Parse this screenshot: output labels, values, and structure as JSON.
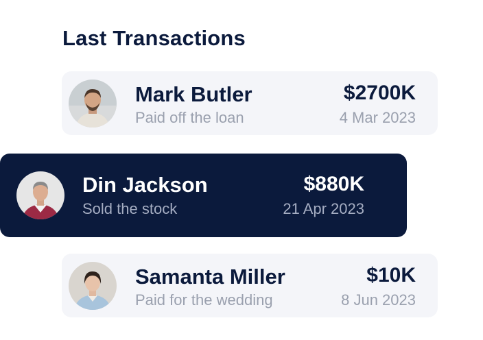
{
  "section": {
    "title": "Last Transactions"
  },
  "transactions": [
    {
      "name": "Mark Butler",
      "description": "Paid off the loan",
      "amount": "$2700K",
      "date": "4 Mar 2023",
      "highlighted": false
    },
    {
      "name": "Din Jackson",
      "description": "Sold the stock",
      "amount": "$880K",
      "date": "21 Apr 2023",
      "highlighted": true
    },
    {
      "name": "Samanta Miller",
      "description": "Paid for the wedding",
      "amount": "$10K",
      "date": "8 Jun 2023",
      "highlighted": false
    }
  ],
  "colors": {
    "primary": "#0b1a3c",
    "card_bg": "#f4f5f9",
    "muted_text": "#9aa0ae"
  }
}
